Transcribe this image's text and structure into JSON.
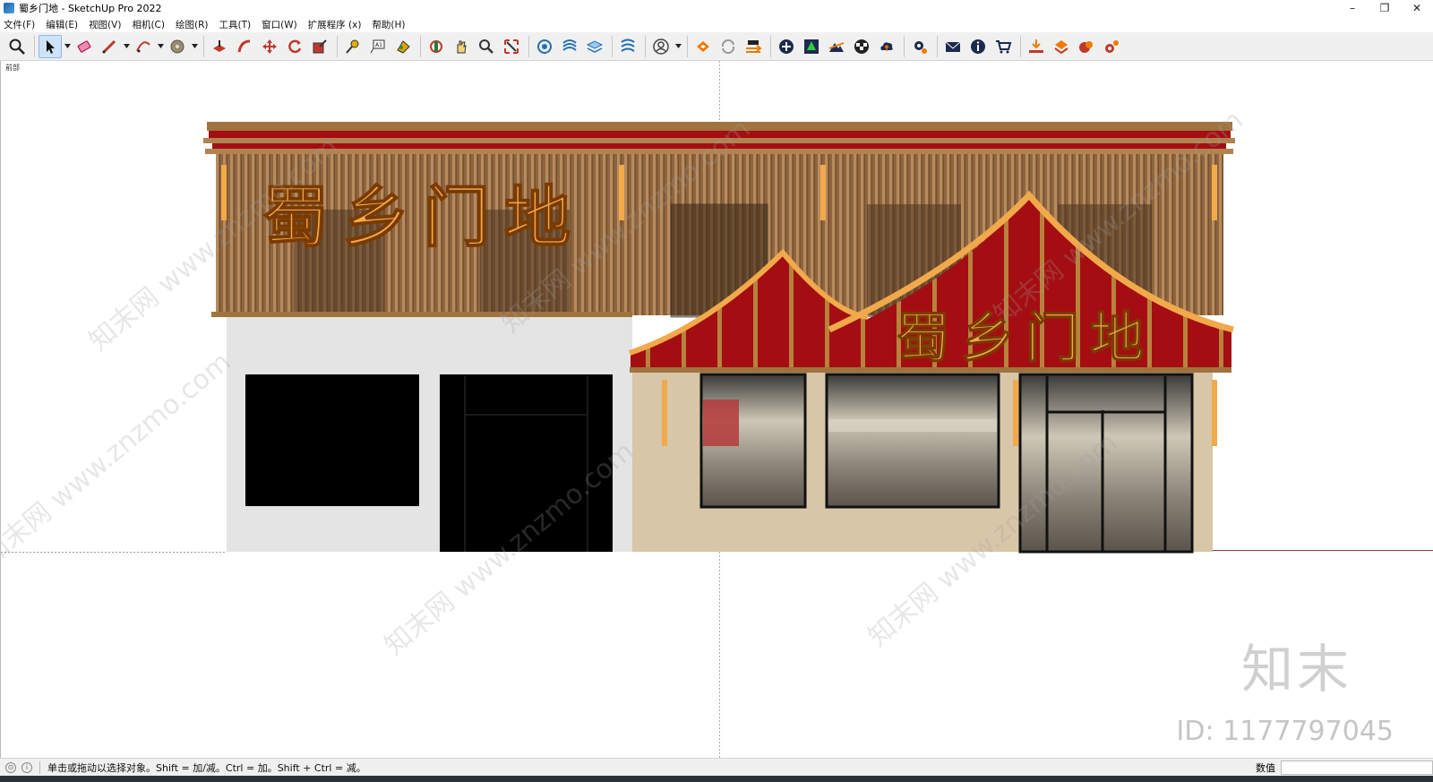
{
  "window": {
    "title": "蜀乡门地 - SketchUp Pro 2022",
    "minimize": "–",
    "restore": "❐",
    "close": "✕"
  },
  "menu": [
    {
      "label": "文件(F)"
    },
    {
      "label": "编辑(E)"
    },
    {
      "label": "视图(V)"
    },
    {
      "label": "相机(C)"
    },
    {
      "label": "绘图(R)"
    },
    {
      "label": "工具(T)"
    },
    {
      "label": "窗口(W)"
    },
    {
      "label": "扩展程序 (x)"
    },
    {
      "label": "帮助(H)"
    }
  ],
  "toolbar": {
    "selected_tool": "select",
    "icons": [
      "zoom-extents-icon",
      "select-icon",
      "eraser-icon",
      "pencil-icon",
      "arc-icon",
      "paint-bucket-icon",
      "push-pull-icon",
      "follow-me-icon",
      "move-icon",
      "rotate-icon",
      "scale-icon",
      "tape-measure-icon",
      "text-icon",
      "paint-icon",
      "orbit-icon",
      "pan-icon",
      "zoom-icon",
      "zoom-window-icon",
      "component-icon",
      "section-icon",
      "layers-icon",
      "styles-icon",
      "account-icon",
      "extension-warehouse-icon",
      "sync-icon",
      "transfer-icon",
      "add-icon",
      "tree-icon",
      "terrain-icon",
      "checker-icon",
      "cloud-upload-icon",
      "settings-icon",
      "mail-icon",
      "info-icon",
      "cart-icon",
      "download-icon",
      "plugin-icon",
      "render-icon",
      "gear-icon"
    ]
  },
  "viewport": {
    "scene_label": "前部",
    "sign_text": "蜀乡门地",
    "watermark_text": "知末网 www.znzmo.com",
    "watermark_logo": "知末",
    "watermark_id": "ID: 1177797045"
  },
  "statusbar": {
    "hint": "单击或拖动以选择对象。Shift = 加/减。Ctrl = 加。Shift + Ctrl = 减。",
    "measure_label": "数值",
    "measure_value": ""
  },
  "colors": {
    "red_roof": "#a40e12",
    "wood": "#9a7148",
    "gold": "#f2a94a",
    "beige_wall": "#d8c6a8"
  }
}
